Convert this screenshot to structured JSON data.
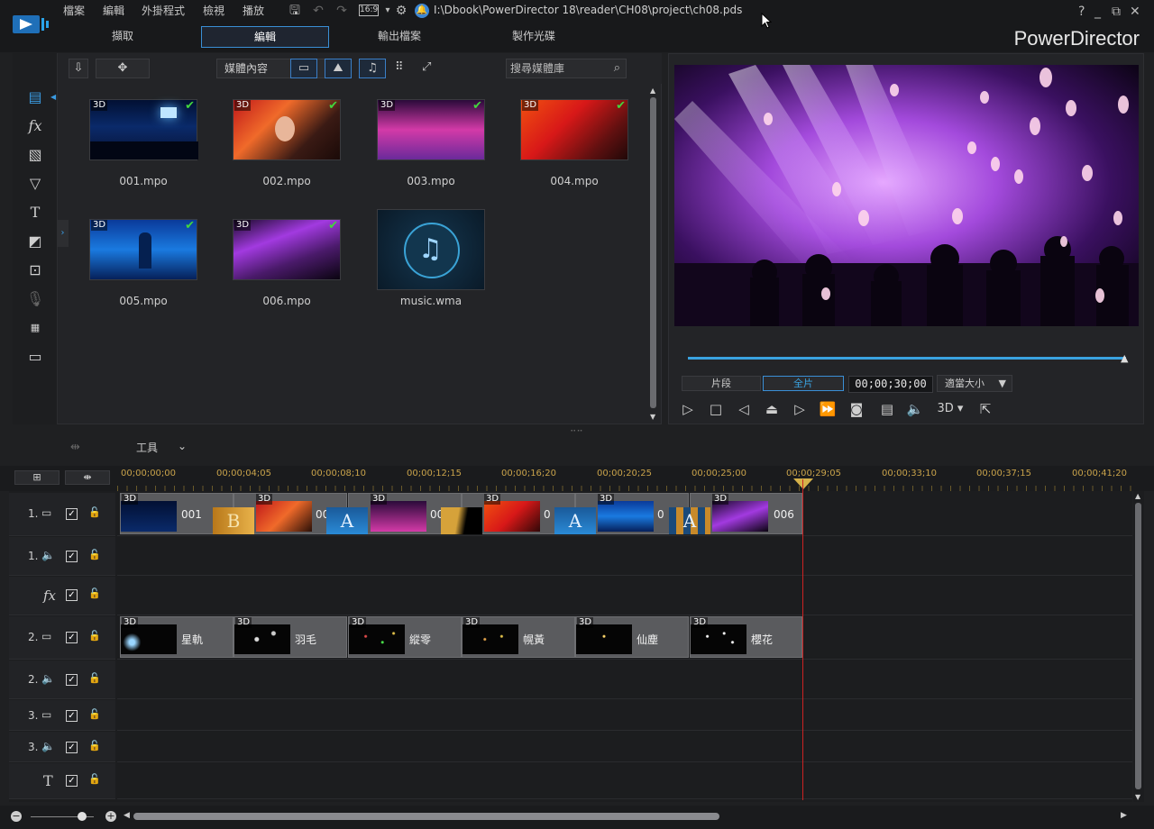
{
  "titlebar": {
    "menu": [
      "檔案",
      "編輯",
      "外掛程式",
      "檢視",
      "播放"
    ],
    "aspect": "16:9",
    "project_path": "I:\\Dbook\\PowerDirector 18\\reader\\CH08\\project\\ch08.pds",
    "window_controls": {
      "help": "?",
      "minimize": "_",
      "restore": "⧉",
      "close": "✕"
    },
    "tabs": [
      "擷取",
      "編輯",
      "輸出檔案",
      "製作光碟"
    ],
    "active_tab": "編輯",
    "brand": "PowerDirector"
  },
  "library": {
    "filter_label": "媒體內容",
    "search_placeholder": "搜尋媒體庫",
    "items": [
      {
        "name": "001.mpo",
        "is3d": "3D",
        "check": "✔"
      },
      {
        "name": "002.mpo",
        "is3d": "3D",
        "check": "✔"
      },
      {
        "name": "003.mpo",
        "is3d": "3D",
        "check": "✔"
      },
      {
        "name": "004.mpo",
        "is3d": "3D",
        "check": "✔"
      },
      {
        "name": "005.mpo",
        "is3d": "3D",
        "check": "✔"
      },
      {
        "name": "006.mpo",
        "is3d": "3D",
        "check": "✔"
      },
      {
        "name": "music.wma",
        "is3d": "",
        "check": ""
      }
    ]
  },
  "preview": {
    "clip_label": "片段",
    "full_label": "全片",
    "timecode": "00;00;30;00",
    "fit_label": "適當大小",
    "mode_3d": "3D"
  },
  "timeline": {
    "tools_label": "工具",
    "ruler": [
      "00;00;00;00",
      "00;00;04;05",
      "00;00;08;10",
      "00;00;12;15",
      "00;00;16;20",
      "00;00;20;25",
      "00;00;25;00",
      "00;00;29;05",
      "00;00;33;10",
      "00;00;37;15",
      "00;00;41;20"
    ],
    "track_labels": {
      "video1": "1.",
      "audio1": "1.",
      "fx": "fx",
      "video2": "2.",
      "audio2": "2.",
      "video3": "3.",
      "audio3": "3.",
      "title": "T"
    },
    "video_clips": [
      "001",
      "00",
      "00",
      "0",
      "0",
      "006"
    ],
    "overlay_clips": [
      "星軌",
      "羽毛",
      "縱零",
      "幌黃",
      "仙塵",
      "櫻花"
    ],
    "transitions": [
      "B",
      "A",
      "",
      "A",
      "A"
    ],
    "badge_3d": "3D"
  },
  "colors": {
    "accent": "#3a8fd6",
    "playhead": "#cc2222",
    "check_green": "#43d63d",
    "ruler_text": "#c8a24a"
  }
}
